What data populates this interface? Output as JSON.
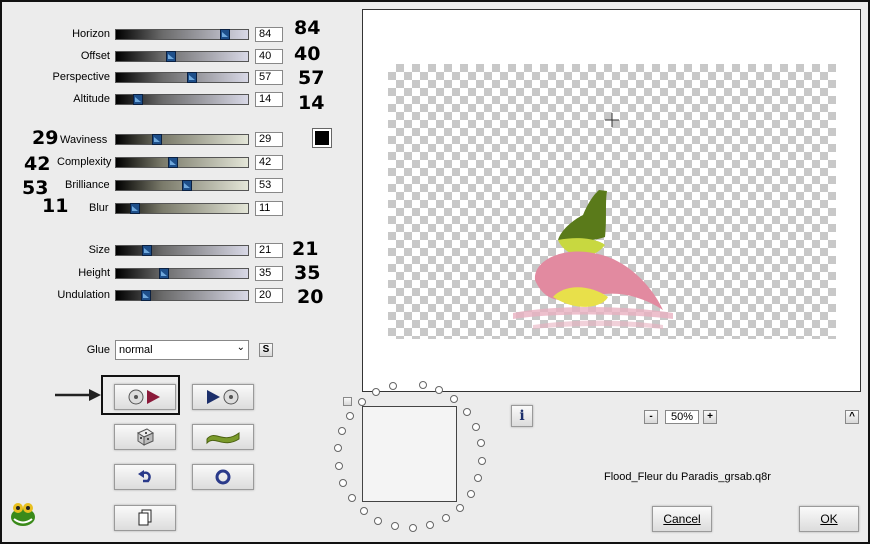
{
  "params": [
    {
      "key": "horizon",
      "label": "Horizon",
      "value": "84",
      "big": "84"
    },
    {
      "key": "offset",
      "label": "Offset",
      "value": "40",
      "big": "40"
    },
    {
      "key": "perspective",
      "label": "Perspective",
      "value": "57",
      "big": "57"
    },
    {
      "key": "altitude",
      "label": "Altitude",
      "value": "14",
      "big": "14"
    },
    {
      "key": "waviness",
      "label": "Waviness",
      "value": "29",
      "big": "29"
    },
    {
      "key": "complexity",
      "label": "Complexity",
      "value": "42",
      "big": "42"
    },
    {
      "key": "brilliance",
      "label": "Brilliance",
      "value": "53",
      "big": "53"
    },
    {
      "key": "blur",
      "label": "Blur",
      "value": "11",
      "big": "11"
    },
    {
      "key": "size",
      "label": "Size",
      "value": "21",
      "big": "21"
    },
    {
      "key": "height",
      "label": "Height",
      "value": "35",
      "big": "35"
    },
    {
      "key": "undulation",
      "label": "Undulation",
      "value": "20",
      "big": "20"
    }
  ],
  "slider_fraction": {
    "horizon": 0.84,
    "offset": 0.4,
    "perspective": 0.57,
    "altitude": 0.14,
    "waviness": 0.29,
    "complexity": 0.42,
    "brilliance": 0.53,
    "blur": 0.11,
    "size": 0.21,
    "height": 0.35,
    "undulation": 0.2
  },
  "glue": {
    "label": "Glue",
    "value": "normal",
    "s_button": "S"
  },
  "color_swatch": "#000000",
  "zoom": {
    "minus": "-",
    "value": "50%",
    "plus": "+"
  },
  "filename": "Flood_Fleur du Paradis_grsab.q8r",
  "info_button": "i",
  "cancel_label": "Cancel",
  "ok_label": "OK",
  "collapse_button": "^",
  "icons": {
    "apply": "disc-play-icon",
    "undo-to": "play-disc-icon",
    "random": "dice-icon",
    "wave": "wave-icon",
    "reset": "undo-arrow-icon",
    "circle": "circle-icon",
    "copy": "copy-icon",
    "arrow": "pointer-arrow-icon",
    "logo": "frog-logo-icon"
  },
  "colors": {
    "thumb": "#1e4f8a",
    "accent": "#8b1a3a"
  }
}
